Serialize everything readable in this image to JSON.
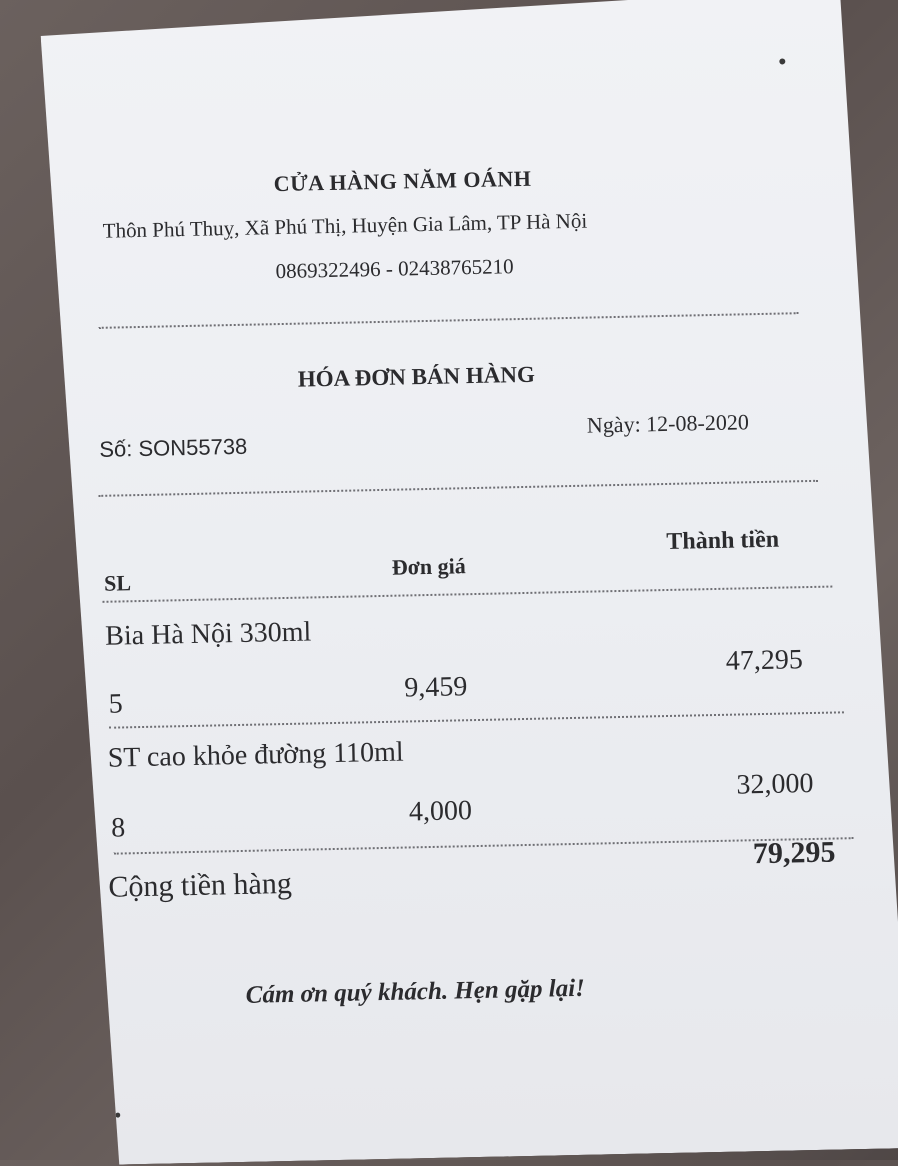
{
  "store": {
    "name": "CỬA HÀNG NĂM OÁNH",
    "address": "Thôn Phú Thuỵ, Xã Phú Thị, Huyện Gia Lâm, TP Hà Nội",
    "phone": "0869322496 - 02438765210"
  },
  "invoice": {
    "title": "HÓA ĐƠN BÁN HÀNG",
    "number": "Số: SON55738",
    "date": "Ngày: 12-08-2020"
  },
  "table": {
    "headers": [
      "SL",
      "Đơn giá",
      "Thành tiền"
    ],
    "items": [
      {
        "name": "Bia Hà Nội 330ml",
        "qty": "5",
        "price": "9,459",
        "total": "47,295"
      },
      {
        "name": "ST cao khỏe đường 110ml",
        "qty": "8",
        "price": "4,000",
        "total": "32,000"
      }
    ]
  },
  "summary": {
    "label": "Cộng tiền hàng",
    "value": "79,295"
  },
  "footer": {
    "thanks": "Cám ơn quý khách. Hẹn gặp lại!"
  }
}
